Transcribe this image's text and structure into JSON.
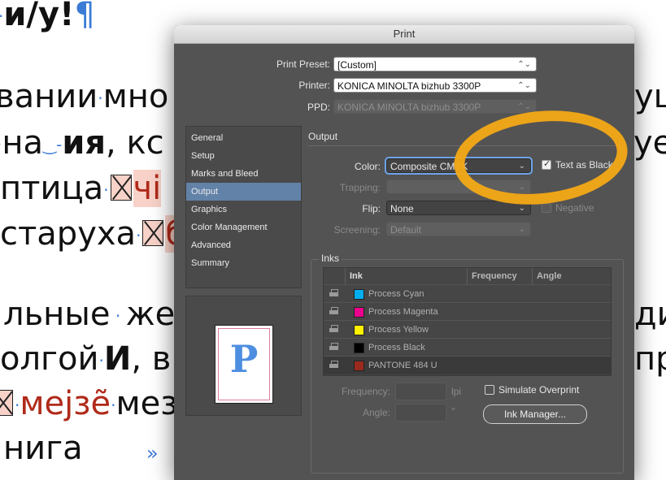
{
  "background_doc": {
    "line1": "и/у!",
    "line2": "вании",
    "line2b": "мно",
    "line2c": "ущ",
    "line3a": "на",
    "line3b": "ия",
    "line3c": ", кс",
    "line3d": "ует",
    "line4a": "птица",
    "line4b": "чі",
    "line5a": "старуха",
    "line5b": "б",
    "line6a": "льные",
    "line6b": "жен",
    "line6c": "дис",
    "line7a": "олгой",
    "line7b": "И",
    "line7c": ", в",
    "line7d": "пр",
    "line8a": "мејзе̃",
    "line8b": "мезе",
    "line9a": "нига",
    "pilcrow": "¶",
    "guillemet": "»"
  },
  "dialog": {
    "title": "Print",
    "print_preset_label": "Print Preset:",
    "print_preset_value": "[Custom]",
    "printer_label": "Printer:",
    "printer_value": "KONICA MINOLTA bizhub 3300P",
    "ppd_label": "PPD:",
    "ppd_value": "KONICA MINOLTA bizhub 3300P",
    "sidebar": [
      {
        "label": "General"
      },
      {
        "label": "Setup"
      },
      {
        "label": "Marks and Bleed"
      },
      {
        "label": "Output"
      },
      {
        "label": "Graphics"
      },
      {
        "label": "Color Management"
      },
      {
        "label": "Advanced"
      },
      {
        "label": "Summary"
      }
    ],
    "active_section": "Output",
    "preview_letter": "P",
    "output": {
      "section_title": "Output",
      "color_label": "Color:",
      "color_value": "Composite CMYK",
      "text_as_black_label": "Text as Black",
      "text_as_black_checked": true,
      "trapping_label": "Trapping:",
      "trapping_value": "",
      "flip_label": "Flip:",
      "flip_value": "None",
      "negative_label": "Negative",
      "screening_label": "Screening:",
      "screening_value": "Default"
    },
    "inks": {
      "section_title": "Inks",
      "headers": {
        "ink": "Ink",
        "frequency": "Frequency",
        "angle": "Angle"
      },
      "rows": [
        {
          "name": "Process Cyan",
          "color": "#00aeef"
        },
        {
          "name": "Process Magenta",
          "color": "#ec008c"
        },
        {
          "name": "Process Yellow",
          "color": "#fff200"
        },
        {
          "name": "Process Black",
          "color": "#000000"
        },
        {
          "name": "PANTONE 484 U",
          "color": "#9b2a1e"
        }
      ],
      "frequency_label": "Frequency:",
      "frequency_unit": "lpi",
      "angle_label": "Angle:",
      "angle_unit": "°",
      "simulate_overprint_label": "Simulate Overprint",
      "ink_manager_label": "Ink Manager..."
    }
  },
  "annotation_color": "#f3a817"
}
